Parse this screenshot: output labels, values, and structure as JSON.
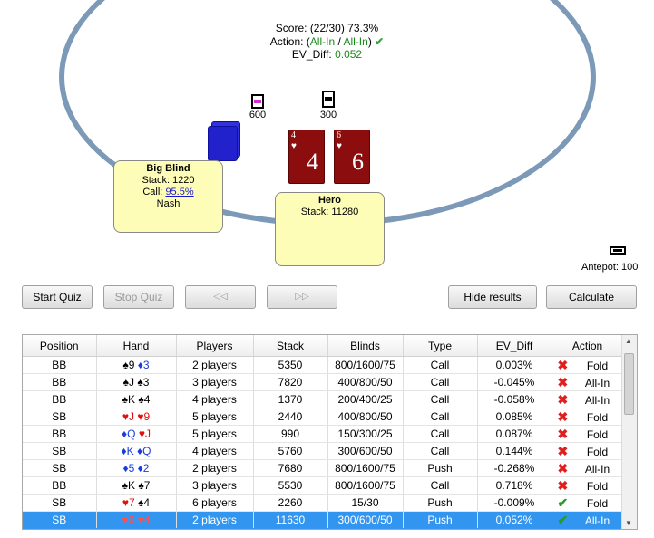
{
  "quiz": {
    "score_label": "Score:",
    "score_value": "(22/30) 73.3%",
    "action_label": "Action: (",
    "action_expected": "All-In",
    "action_sep": " / ",
    "action_chosen": "All-In",
    "action_close": ")",
    "action_icon": "check-icon",
    "ev_label": "EV_Diff:",
    "ev_value": "0.052"
  },
  "chips": [
    {
      "label": "600",
      "color": "#d42ad4"
    },
    {
      "label": "300",
      "color": "#000000"
    }
  ],
  "hero_cards": [
    {
      "rank": "4",
      "suit": "♥"
    },
    {
      "rank": "6",
      "suit": "♥"
    }
  ],
  "players": {
    "big_blind": {
      "name": "Big Blind",
      "stack": "Stack: 1220",
      "call_label": "Call:",
      "call_value": "95.5%",
      "strategy": "Nash"
    },
    "hero": {
      "name": "Hero",
      "stack": "Stack: 11280"
    }
  },
  "antepot": "Antepot: 100",
  "buttons": {
    "start_quiz": "Start Quiz",
    "stop_quiz": "Stop Quiz",
    "prev": "◁◁",
    "next": "▷▷",
    "hide_results": "Hide results",
    "calculate": "Calculate"
  },
  "results": {
    "columns": [
      "Position",
      "Hand",
      "Players",
      "Stack",
      "Blinds",
      "Type",
      "EV_Diff",
      "Action"
    ],
    "rows": [
      {
        "position": "BB",
        "hand": [
          {
            "s": "♠",
            "r": "9",
            "c": "k"
          },
          {
            "s": "♦",
            "r": "3",
            "c": "b"
          }
        ],
        "players": "2 players",
        "stack": "5350",
        "blinds": "800/1600/75",
        "type": "Call",
        "ev": "0.003%",
        "mark": "x",
        "action": "Fold"
      },
      {
        "position": "BB",
        "hand": [
          {
            "s": "♠",
            "r": "J",
            "c": "k"
          },
          {
            "s": "♠",
            "r": "3",
            "c": "k"
          }
        ],
        "players": "3 players",
        "stack": "7820",
        "blinds": "400/800/50",
        "type": "Call",
        "ev": "-0.045%",
        "mark": "x",
        "action": "All-In"
      },
      {
        "position": "BB",
        "hand": [
          {
            "s": "♠",
            "r": "K",
            "c": "k"
          },
          {
            "s": "♠",
            "r": "4",
            "c": "k"
          }
        ],
        "players": "4 players",
        "stack": "1370",
        "blinds": "200/400/25",
        "type": "Call",
        "ev": "-0.058%",
        "mark": "x",
        "action": "All-In"
      },
      {
        "position": "SB",
        "hand": [
          {
            "s": "♥",
            "r": "J",
            "c": "r"
          },
          {
            "s": "♥",
            "r": "9",
            "c": "r"
          }
        ],
        "players": "5 players",
        "stack": "2440",
        "blinds": "400/800/50",
        "type": "Call",
        "ev": "0.085%",
        "mark": "x",
        "action": "Fold"
      },
      {
        "position": "BB",
        "hand": [
          {
            "s": "♦",
            "r": "Q",
            "c": "b"
          },
          {
            "s": "♥",
            "r": "J",
            "c": "r"
          }
        ],
        "players": "5 players",
        "stack": "990",
        "blinds": "150/300/25",
        "type": "Call",
        "ev": "0.087%",
        "mark": "x",
        "action": "Fold"
      },
      {
        "position": "SB",
        "hand": [
          {
            "s": "♦",
            "r": "K",
            "c": "b"
          },
          {
            "s": "♦",
            "r": "Q",
            "c": "b"
          }
        ],
        "players": "4 players",
        "stack": "5760",
        "blinds": "300/600/50",
        "type": "Call",
        "ev": "0.144%",
        "mark": "x",
        "action": "Fold"
      },
      {
        "position": "SB",
        "hand": [
          {
            "s": "♦",
            "r": "5",
            "c": "b"
          },
          {
            "s": "♦",
            "r": "2",
            "c": "b"
          }
        ],
        "players": "2 players",
        "stack": "7680",
        "blinds": "800/1600/75",
        "type": "Push",
        "ev": "-0.268%",
        "mark": "x",
        "action": "All-In"
      },
      {
        "position": "BB",
        "hand": [
          {
            "s": "♠",
            "r": "K",
            "c": "k"
          },
          {
            "s": "♠",
            "r": "7",
            "c": "k"
          }
        ],
        "players": "3 players",
        "stack": "5530",
        "blinds": "800/1600/75",
        "type": "Call",
        "ev": "0.718%",
        "mark": "x",
        "action": "Fold"
      },
      {
        "position": "SB",
        "hand": [
          {
            "s": "♥",
            "r": "7",
            "c": "r"
          },
          {
            "s": "♠",
            "r": "4",
            "c": "k"
          }
        ],
        "players": "6 players",
        "stack": "2260",
        "blinds": "15/30",
        "type": "Push",
        "ev": "-0.009%",
        "mark": "v",
        "action": "Fold"
      },
      {
        "position": "SB",
        "hand": [
          {
            "s": "♥",
            "r": "6",
            "c": "r"
          },
          {
            "s": "♥",
            "r": "4",
            "c": "r"
          }
        ],
        "players": "2 players",
        "stack": "11630",
        "blinds": "300/600/50",
        "type": "Push",
        "ev": "0.052%",
        "mark": "v",
        "action": "All-In",
        "selected": true
      }
    ]
  },
  "colors": {
    "table_rail": "#7c99b8",
    "player_box": "#fdfdb7",
    "card_back": "#2222dd",
    "hero_card": "#8c0d0d",
    "selection": "#3296f0"
  }
}
